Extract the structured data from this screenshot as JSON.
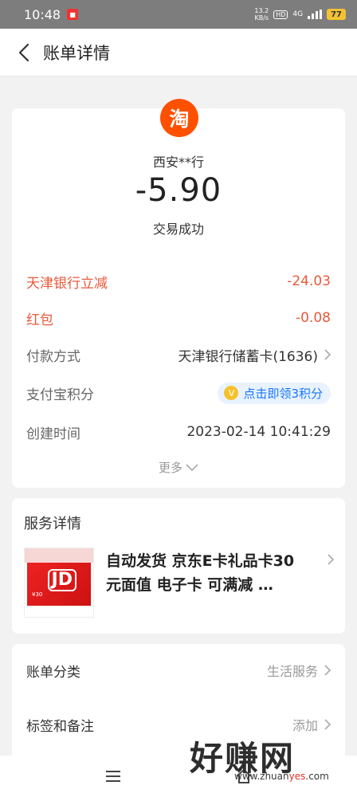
{
  "status_bar": {
    "time": "10:48",
    "net_speed_value": "13.2",
    "net_speed_unit": "KB/s",
    "hd": "HD",
    "network": "4G",
    "battery": "77"
  },
  "nav": {
    "title": "账单详情"
  },
  "bill": {
    "logo_char": "淘",
    "merchant": "西安**行",
    "amount": "-5.90",
    "status": "交易成功",
    "rows": [
      {
        "label": "天津银行立减",
        "value": "-24.03"
      },
      {
        "label": "红包",
        "value": "-0.08"
      },
      {
        "label": "付款方式",
        "value": "天津银行储蓄卡(1636)"
      },
      {
        "label": "支付宝积分",
        "value": "点击即领3积分"
      },
      {
        "label": "创建时间",
        "value": "2023-02-14 10:41:29"
      }
    ],
    "more": "更多"
  },
  "service": {
    "title": "服务详情",
    "product_title": "自动发货 京东E卡礼品卡30元面值 电子卡 可满减 …",
    "thumb_jd": "JD",
    "thumb_price": "¥30"
  },
  "category": {
    "label": "账单分类",
    "value": "生活服务"
  },
  "tags": {
    "label": "标签和备注",
    "value": "添加"
  },
  "watermark": {
    "text": "好赚网",
    "url_prefix": "www.zhuan",
    "url_highlight": "yes",
    "url_suffix": ".com"
  },
  "colors": {
    "accent_red": "#e8593a",
    "taobao_orange": "#ff5000",
    "link_blue": "#1677ff"
  },
  "icons": [
    "back-arrow-icon",
    "chevron-right-icon",
    "chevron-down-icon",
    "menu-icon",
    "home-icon",
    "coin-icon"
  ]
}
